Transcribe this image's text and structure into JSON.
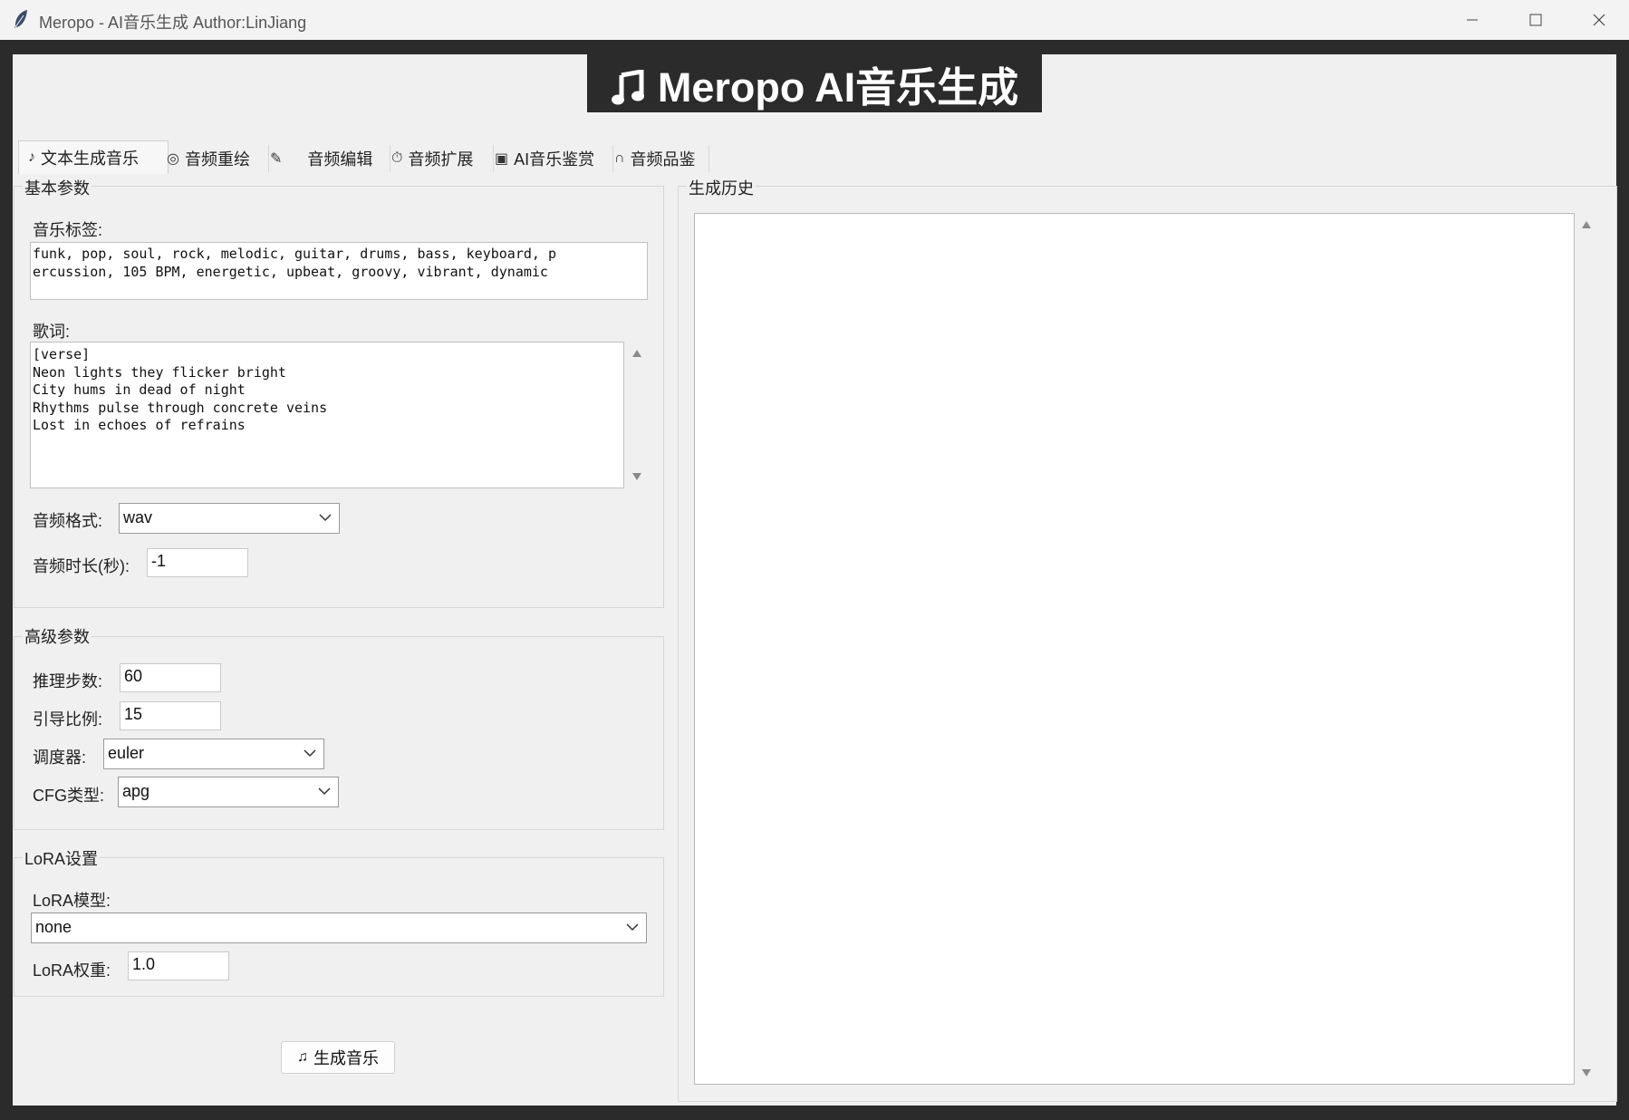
{
  "window": {
    "title": "Meropo - AI音乐生成  Author:LinJiang"
  },
  "banner": {
    "icon": "music-note-icon",
    "text": "Meropo AI音乐生成"
  },
  "tabs": [
    {
      "icon": "♪",
      "label": "文本生成音乐",
      "active": true
    },
    {
      "icon": "◎",
      "label": "音频重绘",
      "active": false
    },
    {
      "icon": "✎",
      "label": "音频编辑",
      "active": false
    },
    {
      "icon": "⏱",
      "label": "音频扩展",
      "active": false
    },
    {
      "icon": "▣",
      "label": "AI音乐鉴赏",
      "active": false
    },
    {
      "icon": "∩",
      "label": "音频品鉴",
      "active": false
    }
  ],
  "basic": {
    "title": "基本参数",
    "tags_label": "音乐标签:",
    "tags_value": "funk, pop, soul, rock, melodic, guitar, drums, bass, keyboard, p\nercussion, 105 BPM, energetic, upbeat, groovy, vibrant, dynamic",
    "lyrics_label": "歌词:",
    "lyrics_value": "[verse]\nNeon lights they flicker bright\nCity hums in dead of night\nRhythms pulse through concrete veins\nLost in echoes of refrains",
    "format_label": "音频格式:",
    "format_value": "wav",
    "duration_label": "音频时长(秒):",
    "duration_value": "-1"
  },
  "advanced": {
    "title": "高级参数",
    "steps_label": "推理步数:",
    "steps_value": "60",
    "guidance_label": "引导比例:",
    "guidance_value": "15",
    "scheduler_label": "调度器:",
    "scheduler_value": "euler",
    "cfg_label": "CFG类型:",
    "cfg_value": "apg"
  },
  "lora": {
    "title": "LoRA设置",
    "model_label": "LoRA模型:",
    "model_value": "none",
    "weight_label": "LoRA权重:",
    "weight_value": "1.0"
  },
  "generate_button": {
    "icon": "♫",
    "label": "生成音乐"
  },
  "history": {
    "title": "生成历史"
  }
}
